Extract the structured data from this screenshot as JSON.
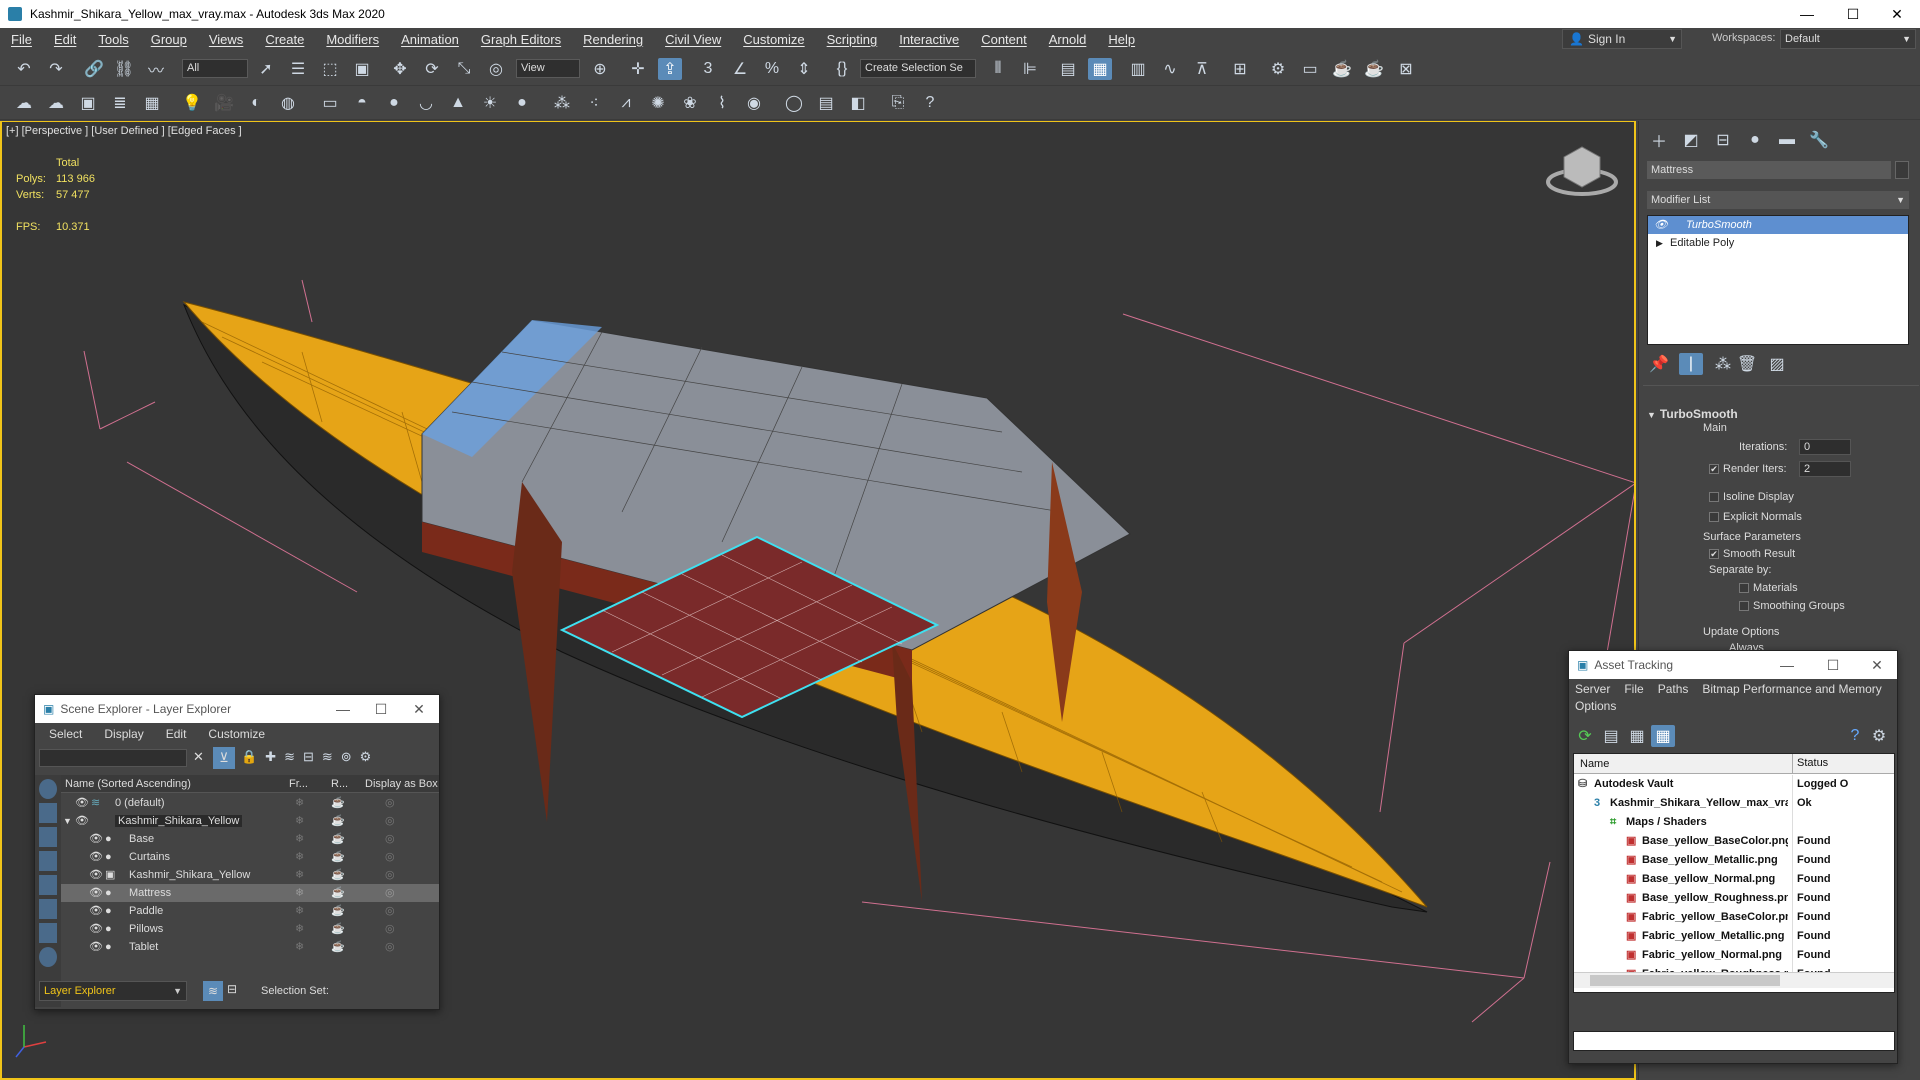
{
  "window": {
    "title": "Kashmir_Shikara_Yellow_max_vray.max - Autodesk 3ds Max 2020"
  },
  "menu": [
    "File",
    "Edit",
    "Tools",
    "Group",
    "Views",
    "Create",
    "Modifiers",
    "Animation",
    "Graph Editors",
    "Rendering",
    "Civil View",
    "Customize",
    "Scripting",
    "Interactive",
    "Content",
    "Arnold",
    "Help"
  ],
  "account": {
    "signin": "Sign In",
    "workspaces_label": "Workspaces:",
    "workspace": "Default"
  },
  "toolbar": {
    "filter": "All",
    "refcoord": "View",
    "selection_set": "Create Selection Se"
  },
  "viewport": {
    "label": "[+] [Perspective ] [User Defined ] [Edged Faces ]",
    "stats": {
      "total_label": "Total",
      "polys_label": "Polys:",
      "polys": "113 966",
      "verts_label": "Verts:",
      "verts": "57 477",
      "fps_label": "FPS:",
      "fps": "10.371"
    }
  },
  "command_panel": {
    "object_name": "Mattress",
    "modifier_list": "Modifier List",
    "stack": [
      "TurboSmooth",
      "Editable Poly"
    ],
    "rollout_title": "TurboSmooth",
    "main_label": "Main",
    "iterations_label": "Iterations:",
    "iterations": "0",
    "render_iters_label": "Render Iters:",
    "render_iters": "2",
    "isoline": "Isoline Display",
    "explicit_normals": "Explicit Normals",
    "surface_params": "Surface Parameters",
    "smooth_result": "Smooth Result",
    "separate_by": "Separate by:",
    "materials": "Materials",
    "smoothing_groups": "Smoothing Groups",
    "update_options": "Update Options",
    "always": "Always"
  },
  "scene_explorer": {
    "title": "Scene Explorer - Layer Explorer",
    "menu": [
      "Select",
      "Display",
      "Edit",
      "Customize"
    ],
    "columns": [
      "Name (Sorted Ascending)",
      "Fr...",
      "R...",
      "Display as Box"
    ],
    "rows": [
      "0 (default)",
      "Kashmir_Shikara_Yellow",
      "Base",
      "Curtains",
      "Kashmir_Shikara_Yellow",
      "Mattress",
      "Paddle",
      "Pillows",
      "Tablet"
    ],
    "footer_explorer": "Layer Explorer",
    "footer_selection": "Selection Set:"
  },
  "asset_tracking": {
    "title": "Asset Tracking",
    "menu": [
      "Server",
      "File",
      "Paths",
      "Bitmap Performance and Memory"
    ],
    "menu2": "Options",
    "columns": [
      "Name",
      "Status"
    ],
    "rows": [
      {
        "name": "Autodesk Vault",
        "status": "Logged O"
      },
      {
        "name": "Kashmir_Shikara_Yellow_max_vray.max",
        "status": "Ok"
      },
      {
        "name": "Maps / Shaders",
        "status": ""
      },
      {
        "name": "Base_yellow_BaseColor.png",
        "status": "Found"
      },
      {
        "name": "Base_yellow_Metallic.png",
        "status": "Found"
      },
      {
        "name": "Base_yellow_Normal.png",
        "status": "Found"
      },
      {
        "name": "Base_yellow_Roughness.png",
        "status": "Found"
      },
      {
        "name": "Fabric_yellow_BaseColor.png",
        "status": "Found"
      },
      {
        "name": "Fabric_yellow_Metallic.png",
        "status": "Found"
      },
      {
        "name": "Fabric_yellow_Normal.png",
        "status": "Found"
      },
      {
        "name": "Fabric_yellow_Roughness.png",
        "status": "Found"
      }
    ]
  }
}
